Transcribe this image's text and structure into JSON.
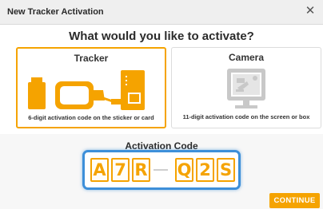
{
  "window": {
    "title": "New Tracker Activation",
    "close_icon": "close-icon"
  },
  "headline": "What would you like to activate?",
  "options": [
    {
      "title": "Tracker",
      "caption": "6-digit activation code on the sticker or card",
      "icon": "tracker-device-icon",
      "selected": true
    },
    {
      "title": "Camera",
      "caption": "11-digit activation code on the screen or box",
      "icon": "camera-device-icon",
      "selected": false
    }
  ],
  "activation": {
    "label": "Activation Code",
    "chars": [
      "A",
      "7",
      "R",
      "Q",
      "2",
      "S"
    ]
  },
  "continue_label": "CONTINUE",
  "colors": {
    "accent": "#f5a300",
    "focus": "#3d8fd9",
    "titlebar": "#efefef",
    "muted_icon": "#c8c8c8"
  }
}
